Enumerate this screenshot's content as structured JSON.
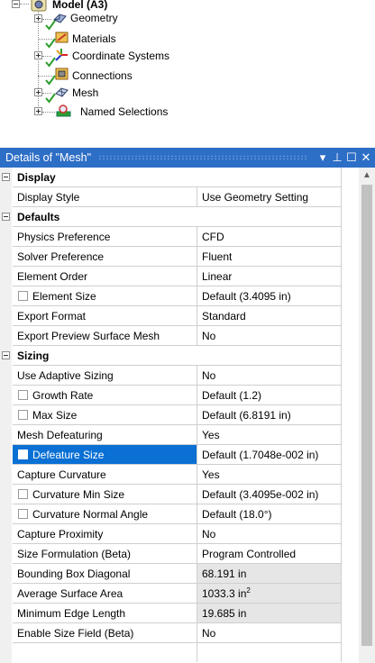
{
  "tree": {
    "root": "Model (A3)",
    "nodes": [
      {
        "label": "Geometry",
        "icon": "geometry-icon",
        "expandable": true
      },
      {
        "label": "Materials",
        "icon": "materials-icon",
        "expandable": false
      },
      {
        "label": "Coordinate Systems",
        "icon": "coordinate-systems-icon",
        "expandable": true
      },
      {
        "label": "Connections",
        "icon": "connections-icon",
        "expandable": false
      },
      {
        "label": "Mesh",
        "icon": "mesh-icon",
        "expandable": true
      },
      {
        "label": "Named Selections",
        "icon": "named-selections-icon",
        "expandable": true
      }
    ]
  },
  "details": {
    "title": "Details of \"Mesh\"",
    "buttons": {
      "dropdown": "▾",
      "pin": "⊥",
      "maximize": "☐",
      "close": "✕"
    },
    "groups": {
      "display": "Display",
      "defaults": "Defaults",
      "sizing": "Sizing"
    },
    "rows": {
      "display_style": {
        "name": "Display Style",
        "value": "Use Geometry Setting"
      },
      "physics_preference": {
        "name": "Physics Preference",
        "value": "CFD"
      },
      "solver_preference": {
        "name": "Solver Preference",
        "value": "Fluent"
      },
      "element_order": {
        "name": "Element Order",
        "value": "Linear"
      },
      "element_size": {
        "name": "Element Size",
        "value": "Default (3.4095 in)"
      },
      "export_format": {
        "name": "Export Format",
        "value": "Standard"
      },
      "export_preview": {
        "name": "Export Preview Surface Mesh",
        "value": "No"
      },
      "use_adaptive_sizing": {
        "name": "Use Adaptive Sizing",
        "value": "No"
      },
      "growth_rate": {
        "name": "Growth Rate",
        "value": "Default (1.2)"
      },
      "max_size": {
        "name": "Max Size",
        "value": "Default (6.8191 in)"
      },
      "mesh_defeaturing": {
        "name": "Mesh Defeaturing",
        "value": "Yes"
      },
      "defeature_size": {
        "name": "Defeature Size",
        "value": "Default (1.7048e-002 in)"
      },
      "capture_curvature": {
        "name": "Capture Curvature",
        "value": "Yes"
      },
      "curvature_min_size": {
        "name": "Curvature Min Size",
        "value": "Default (3.4095e-002 in)"
      },
      "curvature_normal_angle": {
        "name": "Curvature Normal Angle",
        "value": "Default (18.0°)"
      },
      "capture_proximity": {
        "name": "Capture Proximity",
        "value": "No"
      },
      "size_formulation": {
        "name": "Size Formulation (Beta)",
        "value": "Program Controlled"
      },
      "bounding_box_diagonal": {
        "name": "Bounding Box Diagonal",
        "value": "68.191 in"
      },
      "average_surface_area": {
        "name": "Average Surface Area",
        "value": "1033.3 in",
        "unit_sup": "2"
      },
      "minimum_edge_length": {
        "name": "Minimum Edge Length",
        "value": "19.685 in"
      },
      "enable_size_field": {
        "name": "Enable Size Field (Beta)",
        "value": "No"
      }
    }
  },
  "colors": {
    "titlebar": "#2d6ec6",
    "selection": "#0a70d4",
    "check": "#2e9e2e"
  }
}
